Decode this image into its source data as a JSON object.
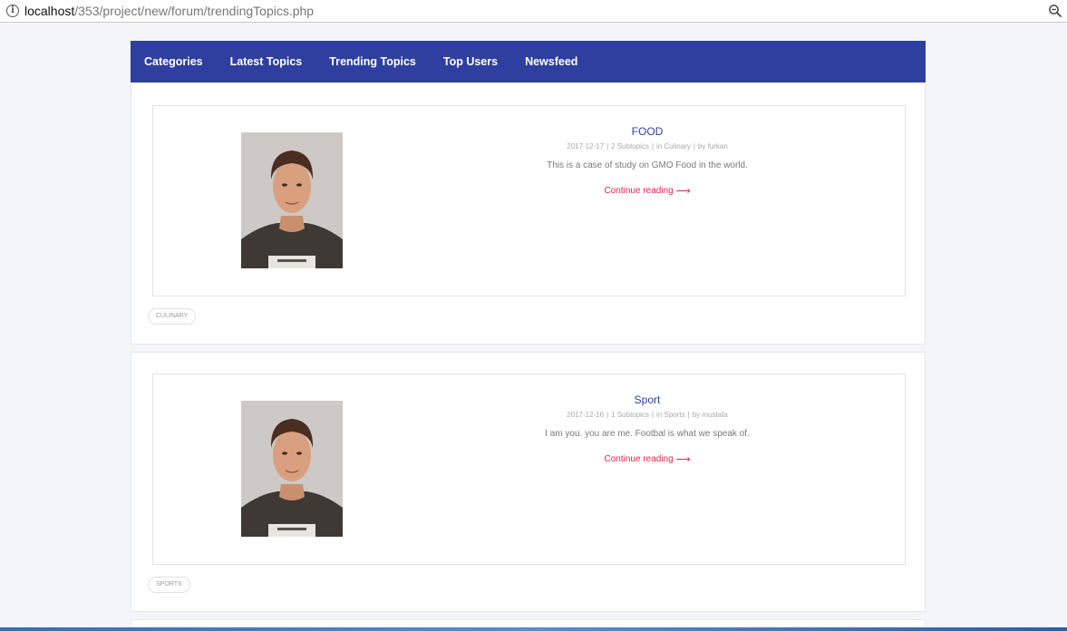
{
  "browser": {
    "url_host": "localhost",
    "url_path": "/353/project/new/forum/trendingTopics.php"
  },
  "nav": {
    "items": [
      {
        "label": "Categories"
      },
      {
        "label": "Latest Topics"
      },
      {
        "label": "Trending Topics"
      },
      {
        "label": "Top Users"
      },
      {
        "label": "Newsfeed"
      }
    ]
  },
  "posts": [
    {
      "title": "FOOD",
      "date": "2017-12-17",
      "subtopics": "2 Subtopics",
      "category": "in Culinary",
      "author": "by furkan",
      "description": "This is a case of study on GMO Food in the world.",
      "more_label": "Continue reading",
      "tag": "CULINARY"
    },
    {
      "title": "Sport",
      "date": "2017-12-16",
      "subtopics": "1 Subtopics",
      "category": "in Sports",
      "author": "by mustafa",
      "description": "I am you. you are me. Footbal is what we speak of.",
      "more_label": "Continue reading",
      "tag": "SPORTS"
    }
  ],
  "colors": {
    "nav_bg": "#2f3f9f",
    "title": "#2f3f9f",
    "link": "#e0264a"
  },
  "icons": {
    "info": "info-icon",
    "zoom": "zoom-icon",
    "arrow": "arrow-right-icon"
  }
}
